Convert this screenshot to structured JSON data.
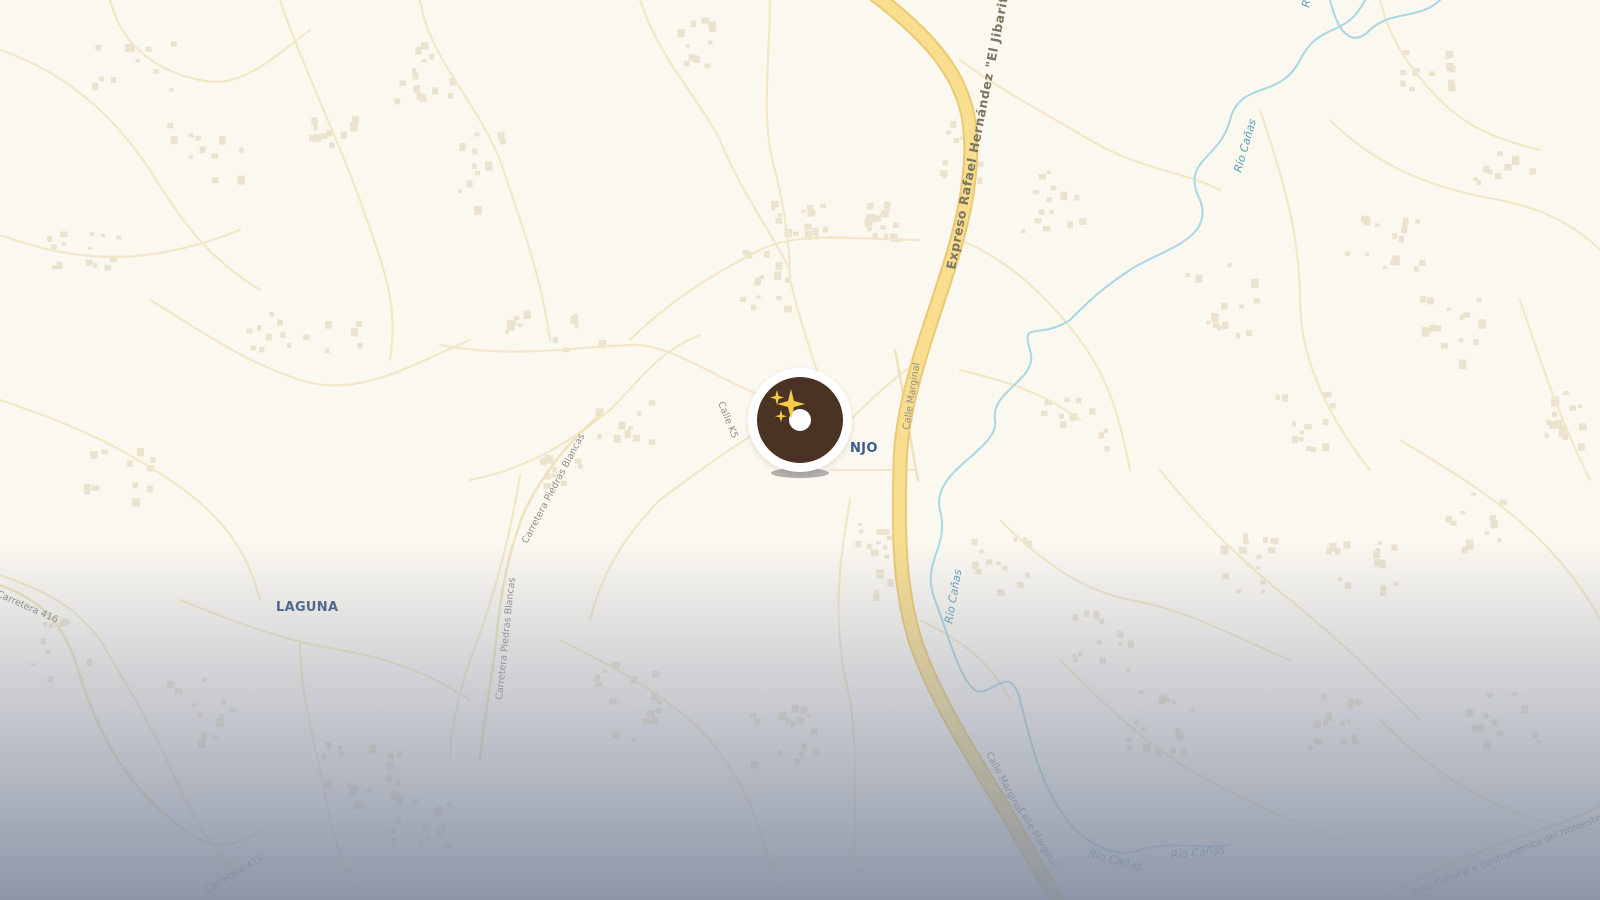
{
  "map": {
    "colors": {
      "land": "#fbf8f0",
      "minor_road": "#f2e8c8",
      "highway_fill": "#f8de8e",
      "highway_casing": "#ecc872",
      "river": "#a9d7e3",
      "place_label": "#3c5a86",
      "bottom_fade": "#848ea2"
    },
    "places": {
      "laguna": "LAGUNA",
      "naranjo_partial": "NJO"
    },
    "highway": {
      "expreso": "Expreso Rafael Hernández \"El Jibarito\""
    },
    "streets": {
      "calle_k5": "Calle K5",
      "calle_marginal": "Calle Marginal",
      "calle_marginal_2": "Calle Marginal",
      "calle_marginal_3": "Calle Marginal",
      "piedras_blancas_1": "Carretera Piedras Blancas",
      "piedras_blancas_2": "Carretera Piedras Blancas",
      "carretera_416_left": "Carretera 416",
      "carretera_416_bottom": "Carretera 416",
      "ruta_cultural": "Ruta Cultural y Gastronómica del Noroeste"
    },
    "rivers": {
      "canas_top": "Río Cañas",
      "canas_upper": "Río Cañas",
      "canas_mid": "Río Cañas",
      "canas_bottom_1": "Río Cañas",
      "canas_bottom_2": "Río Cañas"
    },
    "marker": {
      "icon": "donut-sparkle-icon",
      "colors": {
        "donut": "#4a3322",
        "ring": "#ffffff",
        "sparkle": "#f6cc45"
      }
    }
  }
}
